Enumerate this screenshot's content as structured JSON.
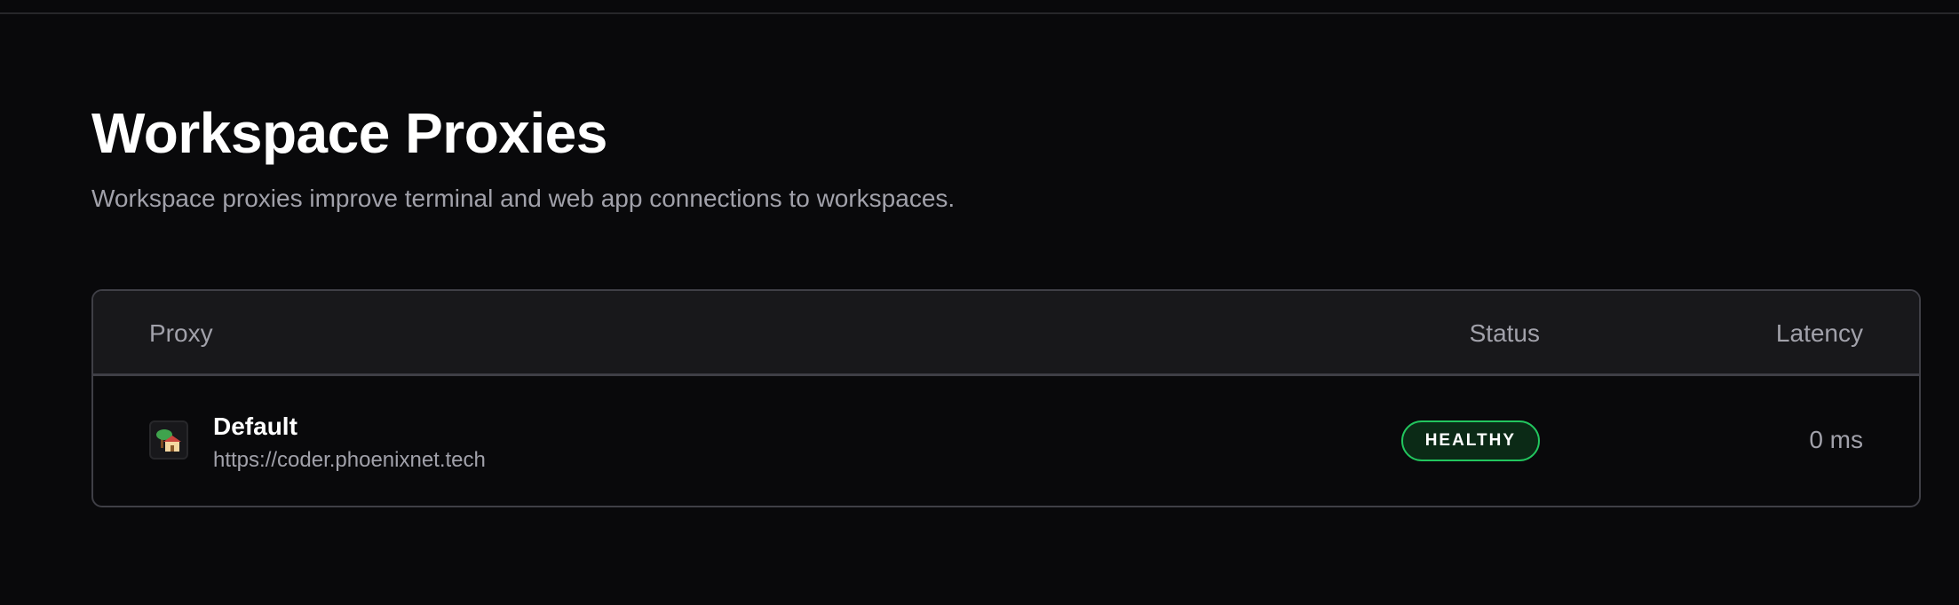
{
  "page": {
    "title": "Workspace Proxies",
    "description": "Workspace proxies improve terminal and web app connections to workspaces."
  },
  "table": {
    "columns": {
      "proxy": "Proxy",
      "status": "Status",
      "latency": "Latency"
    },
    "rows": [
      {
        "icon": "house-tree-icon",
        "name": "Default",
        "url": "https://coder.phoenixnet.tech",
        "status": "HEALTHY",
        "latency": "0 ms"
      }
    ]
  },
  "colors": {
    "background": "#09090b",
    "header_background": "#18181b",
    "border": "#3f3f46",
    "muted_text": "#a1a1aa",
    "healthy": "#22c55e"
  }
}
